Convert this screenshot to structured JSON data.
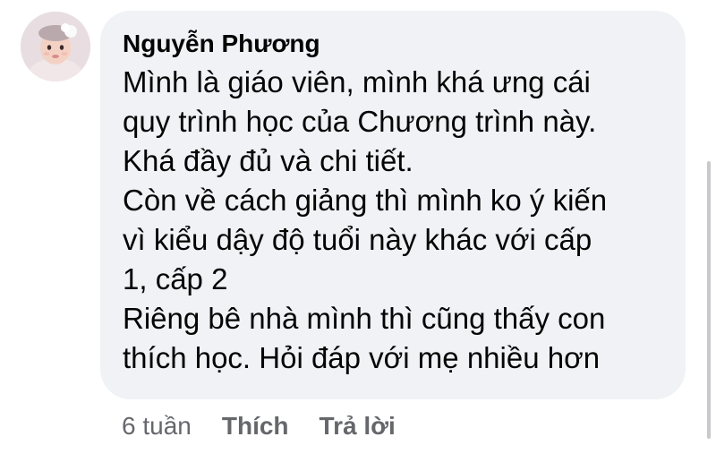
{
  "comment": {
    "author": "Nguyễn Phương",
    "avatar_icon": "profile-photo-baby-avatar",
    "lines": [
      "Mình là giáo viên, mình khá ưng cái",
      "quy trình học của Chương trình này.",
      "Khá đầy đủ và chi tiết.",
      "Còn về cách giảng thì mình ko ý kiến",
      "vì kiểu dậy độ tuổi này khác với cấp",
      "1, cấp 2",
      "Riêng bê nhà mình thì cũng thấy con",
      "thích học. Hỏi đáp với mẹ nhiều hơn"
    ],
    "timestamp": "6 tuần",
    "like_label": "Thích",
    "reply_label": "Trả lời"
  },
  "colors": {
    "bubble_background": "#f0f2f5",
    "text_primary": "#050505",
    "text_secondary": "#65676b"
  }
}
